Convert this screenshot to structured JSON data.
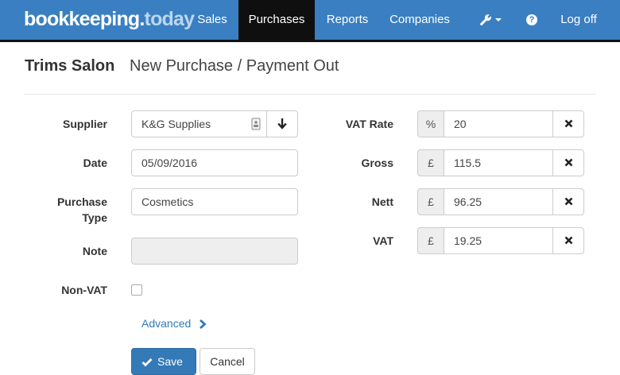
{
  "brand": {
    "part1": "bookkeeping",
    "part2": ".",
    "part3": "today"
  },
  "nav": {
    "sales": "Sales",
    "purchases": "Purchases",
    "reports": "Reports",
    "companies": "Companies",
    "help": "?",
    "logoff": "Log off"
  },
  "header": {
    "company": "Trims Salon",
    "title": "New Purchase / Payment Out"
  },
  "form": {
    "supplier_label": "Supplier",
    "supplier_value": "K&G Supplies",
    "date_label": "Date",
    "date_value": "05/09/2016",
    "purchase_type_label_1": "Purchase",
    "purchase_type_label_2": "Type",
    "purchase_type_value": "Cosmetics",
    "note_label": "Note",
    "note_value": "",
    "nonvat_label": "Non-VAT",
    "advanced_link": "Advanced",
    "vat_rate_label": "VAT Rate",
    "vat_rate_symbol": "%",
    "vat_rate_value": "20",
    "gross_label": "Gross",
    "gross_symbol": "£",
    "gross_value": "115.5",
    "nett_label": "Nett",
    "nett_symbol": "£",
    "nett_value": "96.25",
    "vat_label": "VAT",
    "vat_symbol": "£",
    "vat_value": "19.25",
    "save_label": "Save",
    "cancel_label": "Cancel"
  },
  "colors": {
    "navbar": "#3a7fc1",
    "active_tab": "#0f0f0f",
    "primary": "#337ab7"
  },
  "icons": [
    "wrench-icon",
    "help-icon",
    "contact-card-icon",
    "arrow-down-icon",
    "clear-x-icon",
    "chevron-right-icon",
    "check-icon"
  ]
}
